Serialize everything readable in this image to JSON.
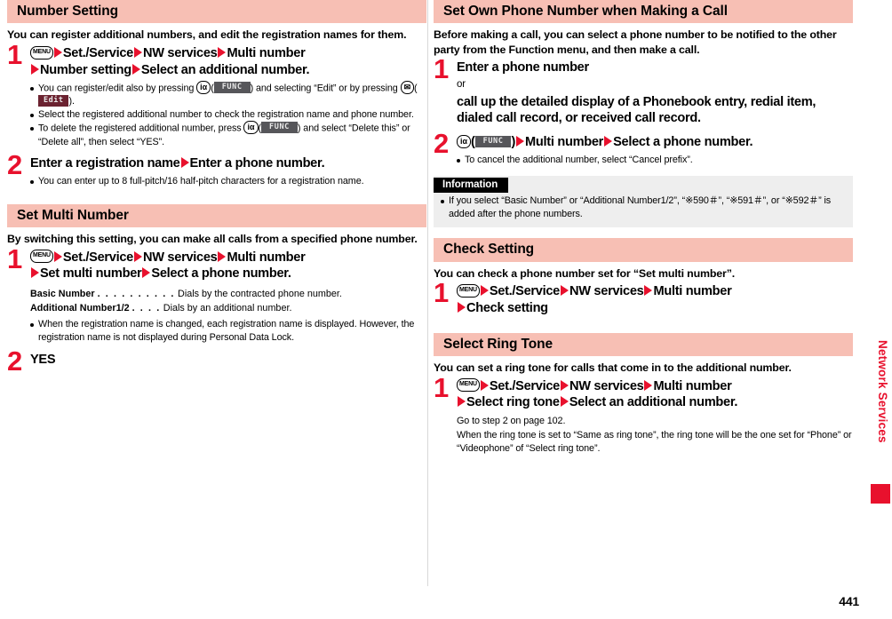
{
  "page": {
    "number": "441",
    "edge_title": "Network Services"
  },
  "left_column": {
    "sections": [
      {
        "id": "number-setting",
        "title": "Number Setting",
        "lead": "You can register additional numbers, and edit the registration names for them.",
        "steps": [
          {
            "num": "1",
            "line1_key": "MENU",
            "line1_parts": [
              "Set./Service",
              "NW services",
              "Multi number"
            ],
            "line2_parts": [
              "Number setting",
              "Select an additional number."
            ],
            "bullets": [
              "You can register/edit also by pressing  iα ( FUNC ) and selecting “Edit” or by pressing  ✉ ( Edit ).",
              "Select the registered additional number to check the registration name and phone number.",
              "To delete the registered additional number, press  iα ( FUNC ) and select “Delete this” or “Delete all”, then select “YES”."
            ]
          },
          {
            "num": "2",
            "line1_parts": [
              "Enter a registration name",
              "Enter a phone number."
            ],
            "bullets": [
              "You can enter up to 8 full-pitch/16 half-pitch characters for a registration name."
            ]
          }
        ]
      },
      {
        "id": "set-multi-number",
        "title": "Set Multi Number",
        "lead": "By switching this setting, you can make all calls from a specified phone number.",
        "steps": [
          {
            "num": "1",
            "line1_key": "MENU",
            "line1_parts": [
              "Set./Service",
              "NW services",
              "Multi number"
            ],
            "line2_parts": [
              "Set multi number",
              "Select a phone number."
            ],
            "definitions": [
              {
                "term": "Basic Number",
                "leader": ". . . . . . . . . .",
                "desc": "Dials by the contracted phone number."
              },
              {
                "term": "Additional Number1/2",
                "leader": ". . . .",
                "desc": "Dials by an additional number."
              }
            ],
            "bullets": [
              "When the registration name is changed, each registration name is displayed. However, the registration name is not displayed during Personal Data Lock."
            ]
          },
          {
            "num": "2",
            "line1_plain": "YES"
          }
        ]
      }
    ]
  },
  "right_column": {
    "sections": [
      {
        "id": "set-own-phone-number",
        "title": "Set Own Phone Number when Making a Call",
        "lead": "Before making a call, you can select a phone number to be notified to the other party from the Function menu, and then make a call.",
        "steps": [
          {
            "num": "1",
            "line1_plain": "Enter a phone number",
            "line_or": "or",
            "line_cont": "call up the detailed display of a Phonebook entry, redial item, dialed call record, or received call record."
          },
          {
            "num": "2",
            "key_ia": "iα",
            "softkey": "FUNC",
            "line1_parts": [
              "Multi number",
              "Select a phone number."
            ],
            "bullets": [
              "To cancel the additional number, select “Cancel prefix”."
            ]
          }
        ],
        "information": {
          "title": "Information",
          "bullets": [
            "If you select “Basic Number” or “Additional Number1/2”, “※590＃”, “※591＃”, or “※592＃” is added after the phone numbers."
          ]
        }
      },
      {
        "id": "check-setting",
        "title": "Check Setting",
        "lead": "You can check a phone number set for “Set multi number”.",
        "steps": [
          {
            "num": "1",
            "line1_key": "MENU",
            "line1_parts": [
              "Set./Service",
              "NW services",
              "Multi number"
            ],
            "line2_parts": [
              "Check setting"
            ]
          }
        ]
      },
      {
        "id": "select-ring-tone",
        "title": "Select Ring Tone",
        "lead": "You can set a ring tone for calls that come in to the additional number.",
        "steps": [
          {
            "num": "1",
            "line1_key": "MENU",
            "line1_parts": [
              "Set./Service",
              "NW services",
              "Multi number"
            ],
            "line2_parts": [
              "Select ring tone",
              "Select an additional number."
            ],
            "notes": [
              "Go to step 2 on page 102.",
              "When the ring tone is set to “Same as ring tone”, the ring tone will be the one set for “Phone” or “Videophone” of “Select ring tone”."
            ]
          }
        ]
      }
    ]
  },
  "icons": {
    "menu_key": "MENU",
    "ia_key_i": "i",
    "ia_key_alpha": "α",
    "mail_key": "✉",
    "func_softkey": "FUNC",
    "edit_softkey": "Edit"
  }
}
